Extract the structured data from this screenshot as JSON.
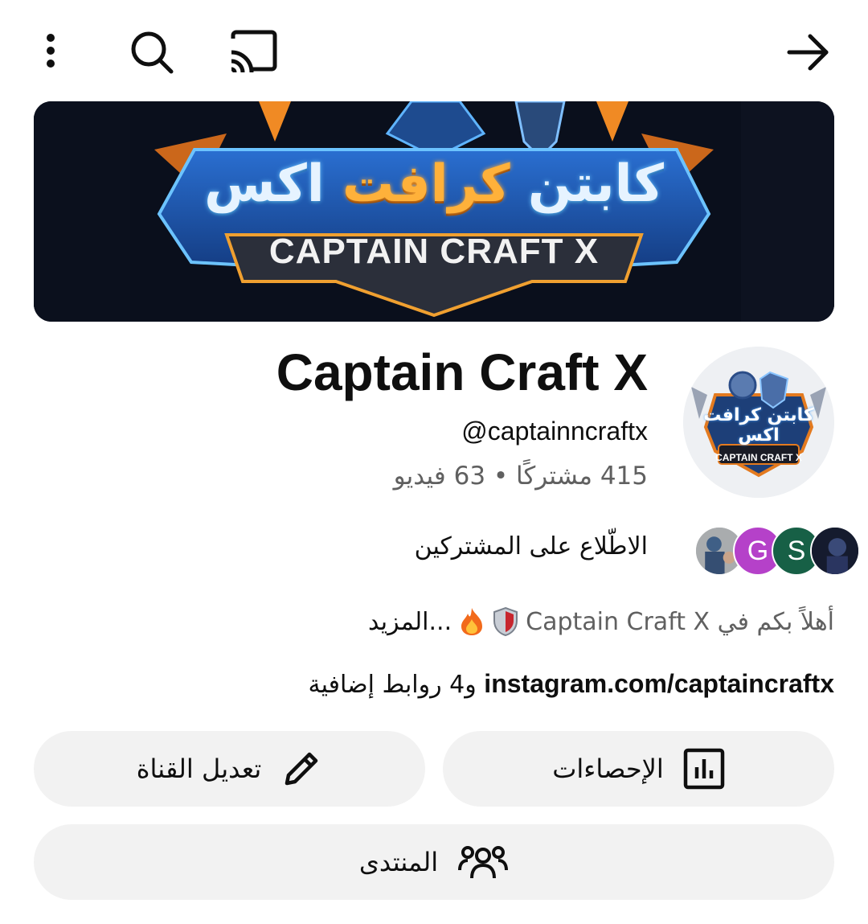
{
  "top_bar": {
    "icons": [
      "more-vertical-icon",
      "search-icon",
      "cast-icon",
      "back-arrow-icon"
    ]
  },
  "banner": {
    "title_ar_part1": "كابتن",
    "title_ar_part2": "كرافت",
    "title_ar_part3": "اكس",
    "title_en": "CAPTAIN CRAFT X"
  },
  "avatar": {
    "title_ar": "كابتن كرافت اكس",
    "title_en": "CAPTAIN CRAFT X"
  },
  "channel": {
    "name": "Captain Craft X",
    "handle": "@captainncraftx",
    "stats": "415 مشتركًا • 63 فيديو"
  },
  "subscribers": {
    "avatars": [
      {
        "letter": "",
        "color": "#b7b9bb"
      },
      {
        "letter": "G",
        "color": "#b541c9"
      },
      {
        "letter": "S",
        "color": "#176046"
      },
      {
        "letter": "",
        "color": "#1b2236"
      }
    ],
    "link_label": "الاطّلاع على المشتركين"
  },
  "description": {
    "text": "أهلاً بكم في Captain Craft X",
    "emojis": [
      "shield-emoji",
      "fire-emoji"
    ],
    "more": "...المزيد"
  },
  "links": {
    "url": "instagram.com/captaincraftx",
    "extra": "و4 روابط إضافية"
  },
  "buttons": {
    "stats_label": "الإحصاءات",
    "edit_label": "تعديل القناة",
    "community_label": "المنتدى"
  },
  "colors": {
    "text_primary": "#0f0f0f",
    "text_secondary": "#606060",
    "pill_bg": "#f2f2f2",
    "subscriber_g": "#b541c9",
    "subscriber_s": "#176046"
  }
}
